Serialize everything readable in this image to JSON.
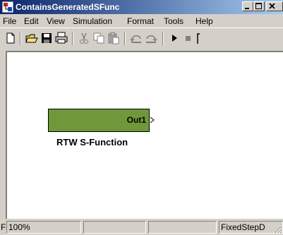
{
  "window": {
    "title": "ContainsGeneratedSFunc",
    "buttons": [
      "minimize-icon",
      "maximize-icon",
      "close-icon"
    ]
  },
  "menu": {
    "items": [
      "File",
      "Edit",
      "View",
      "Simulation",
      "Format",
      "Tools",
      "Help"
    ]
  },
  "toolbar": {
    "icons": [
      "new-icon",
      "open-icon",
      "save-icon",
      "print-icon",
      "cut-icon",
      "copy-icon",
      "paste-icon",
      "undo-icon",
      "redo-icon",
      "start-icon",
      "stop-icon"
    ]
  },
  "diagram": {
    "block": {
      "port_label": "Out1",
      "name": "RTW S-Function",
      "color": "#70983a"
    }
  },
  "status": {
    "left_fragment": "F",
    "zoom": "100%",
    "cell2": "",
    "cell3": "",
    "solver": "FixedStepD"
  }
}
